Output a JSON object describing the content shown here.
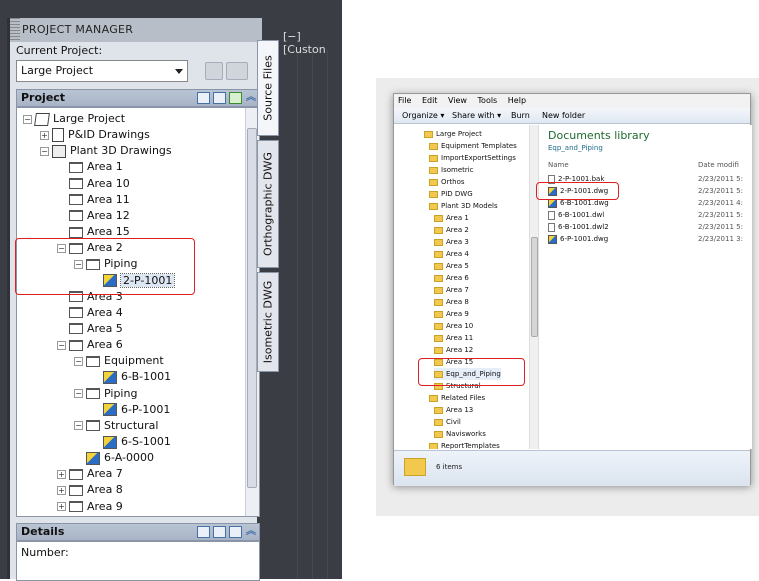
{
  "project_manager": {
    "title": "PROJECT MANAGER",
    "current_project_label": "Current Project:",
    "current_project_value": "Large Project",
    "project_header": "Project",
    "details_header": "Details",
    "details_number_label": "Number:",
    "viewport_label": "[−] [Custon",
    "side_tabs": [
      "Source Files",
      "Orthographic DWG",
      "Isometric DWG"
    ],
    "tree": [
      {
        "label": "Large Project",
        "level": 0,
        "icon": "project-icon",
        "exp": "−"
      },
      {
        "label": "P&ID Drawings",
        "level": 1,
        "icon": "pid-icon",
        "exp": "+"
      },
      {
        "label": "Plant 3D Drawings",
        "level": 1,
        "icon": "plant3d-icon",
        "exp": "−"
      },
      {
        "label": "Area 1",
        "level": 2,
        "icon": "folder-icon"
      },
      {
        "label": "Area 10",
        "level": 2,
        "icon": "folder-icon"
      },
      {
        "label": "Area 11",
        "level": 2,
        "icon": "folder-icon"
      },
      {
        "label": "Area 12",
        "level": 2,
        "icon": "folder-icon"
      },
      {
        "label": "Area 15",
        "level": 2,
        "icon": "folder-icon"
      },
      {
        "label": "Area 2",
        "level": 2,
        "icon": "folder-icon",
        "exp": "−"
      },
      {
        "label": "Piping",
        "level": 3,
        "icon": "folder-icon",
        "exp": "−"
      },
      {
        "label": "2-P-1001",
        "level": 4,
        "icon": "dwg-icon",
        "selected": true
      },
      {
        "label": "Area 3",
        "level": 2,
        "icon": "folder-icon"
      },
      {
        "label": "Area 4",
        "level": 2,
        "icon": "folder-icon"
      },
      {
        "label": "Area 5",
        "level": 2,
        "icon": "folder-icon"
      },
      {
        "label": "Area 6",
        "level": 2,
        "icon": "folder-icon",
        "exp": "−"
      },
      {
        "label": "Equipment",
        "level": 3,
        "icon": "folder-icon",
        "exp": "−"
      },
      {
        "label": "6-B-1001",
        "level": 4,
        "icon": "dwg-icon"
      },
      {
        "label": "Piping",
        "level": 3,
        "icon": "folder-icon",
        "exp": "−"
      },
      {
        "label": "6-P-1001",
        "level": 4,
        "icon": "dwg-icon"
      },
      {
        "label": "Structural",
        "level": 3,
        "icon": "folder-icon",
        "exp": "−"
      },
      {
        "label": "6-S-1001",
        "level": 4,
        "icon": "dwg-icon"
      },
      {
        "label": "6-A-0000",
        "level": 3,
        "icon": "dwg-icon"
      },
      {
        "label": "Area 7",
        "level": 2,
        "icon": "folder-icon",
        "exp": "+"
      },
      {
        "label": "Area 8",
        "level": 2,
        "icon": "folder-icon",
        "exp": "+"
      },
      {
        "label": "Area 9",
        "level": 2,
        "icon": "folder-icon",
        "exp": "+"
      }
    ]
  },
  "explorer": {
    "menu": [
      "File",
      "Edit",
      "View",
      "Tools",
      "Help"
    ],
    "commands": {
      "organize": "Organize ▾",
      "share": "Share with ▾",
      "burn": "Burn",
      "new_folder": "New folder"
    },
    "library_title": "Documents library",
    "library_sub": "Eqp_and_Piping",
    "col_name": "Name",
    "col_date": "Date modifi",
    "status": "6 items",
    "nav": [
      {
        "label": "Large Project",
        "indent": 0
      },
      {
        "label": "Equipment Templates",
        "indent": 1
      },
      {
        "label": "ImportExportSettings",
        "indent": 1
      },
      {
        "label": "Isometric",
        "indent": 1
      },
      {
        "label": "Orthos",
        "indent": 1
      },
      {
        "label": "PID DWG",
        "indent": 1
      },
      {
        "label": "Plant 3D Models",
        "indent": 1
      },
      {
        "label": "Area 1",
        "indent": 2
      },
      {
        "label": "Area 2",
        "indent": 2
      },
      {
        "label": "Area 3",
        "indent": 2
      },
      {
        "label": "Area 4",
        "indent": 2
      },
      {
        "label": "Area 5",
        "indent": 2
      },
      {
        "label": "Area 6",
        "indent": 2
      },
      {
        "label": "Area 7",
        "indent": 2
      },
      {
        "label": "Area 8",
        "indent": 2
      },
      {
        "label": "Area 9",
        "indent": 2
      },
      {
        "label": "Area 10",
        "indent": 2
      },
      {
        "label": "Area 11",
        "indent": 2
      },
      {
        "label": "Area 12",
        "indent": 2
      },
      {
        "label": "Area 15",
        "indent": 2
      },
      {
        "label": "Eqp_and_Piping",
        "indent": 2,
        "selected": true
      },
      {
        "label": "Structural",
        "indent": 2
      },
      {
        "label": "Related Files",
        "indent": 1
      },
      {
        "label": "Area 13",
        "indent": 2
      },
      {
        "label": "Civil",
        "indent": 2
      },
      {
        "label": "Navisworks",
        "indent": 2
      },
      {
        "label": "ReportTemplates",
        "indent": 1
      }
    ],
    "files": [
      {
        "name": "2-P-1001.bak",
        "date": "2/23/2011 5:",
        "icon": "file-icon"
      },
      {
        "name": "2-P-1001.dwg",
        "date": "2/23/2011 5:",
        "icon": "dwg-icon"
      },
      {
        "name": "6-B-1001.dwg",
        "date": "2/23/2011 4:",
        "icon": "dwg-icon"
      },
      {
        "name": "6-B-1001.dwl",
        "date": "2/23/2011 5:",
        "icon": "file-icon"
      },
      {
        "name": "6-B-1001.dwl2",
        "date": "2/23/2011 5:",
        "icon": "file-icon"
      },
      {
        "name": "6-P-1001.dwg",
        "date": "2/23/2011 3:",
        "icon": "dwg-icon"
      }
    ]
  },
  "colors": {
    "highlight": "#e02020",
    "library_title": "#1e6b2e"
  }
}
